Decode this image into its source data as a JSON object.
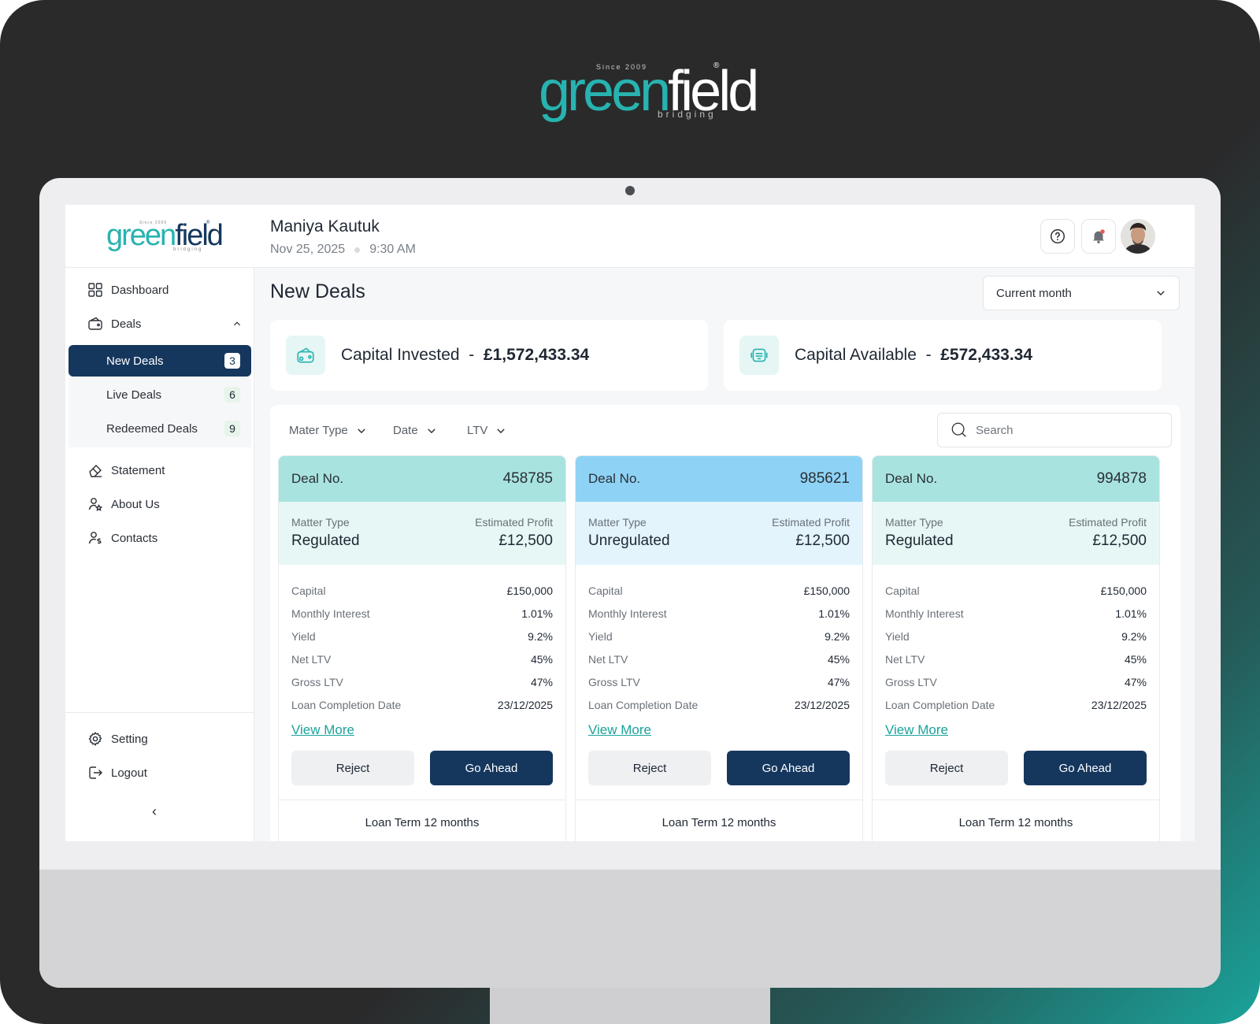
{
  "brand": {
    "prefix": "green",
    "suffix": "field",
    "since": "Since 2009",
    "sub": "bridging",
    "reg": "®"
  },
  "user": {
    "name": "Maniya Kautuk",
    "date": "Nov 25, 2025",
    "time": "9:30 AM"
  },
  "sidebar": {
    "items": [
      {
        "label": "Dashboard",
        "icon": "grid-icon"
      },
      {
        "label": "Deals",
        "icon": "wallet-icon"
      }
    ],
    "sub_items": [
      {
        "label": "New Deals",
        "count": "3"
      },
      {
        "label": "Live Deals",
        "count": "6"
      },
      {
        "label": "Redeemed Deals",
        "count": "9"
      }
    ],
    "more_items": [
      {
        "label": "Statement",
        "icon": "eraser-icon"
      },
      {
        "label": "About Us",
        "icon": "user-star-icon"
      },
      {
        "label": "Contacts",
        "icon": "user-dollar-icon"
      }
    ],
    "bottom_items": [
      {
        "label": "Setting",
        "icon": "gear-icon"
      },
      {
        "label": "Logout",
        "icon": "logout-icon"
      }
    ],
    "collapse_glyph": "‹"
  },
  "main": {
    "title": "New Deals",
    "period": "Current month",
    "capital_invested": {
      "label": "Capital Invested",
      "sep": "-",
      "value": "£1,572,433.34"
    },
    "capital_available": {
      "label": "Capital Available",
      "sep": "-",
      "value": "£572,433.34"
    },
    "filters": [
      "Mater Type",
      "Date",
      "LTV"
    ],
    "search_placeholder": "Search"
  },
  "deal_labels": {
    "deal_no": "Deal No.",
    "matter_type": "Matter Type",
    "estimated_profit": "Estimated Profit",
    "view_more": "View More",
    "reject": "Reject",
    "go_ahead": "Go Ahead"
  },
  "deals": [
    {
      "number": "458785",
      "matter": "Regulated",
      "profit": "£12,500",
      "head_color": "#a8e3df",
      "sub_color": "#e6f7f5",
      "rows": [
        [
          "Capital",
          "£150,000"
        ],
        [
          "Monthly Interest",
          "1.01%"
        ],
        [
          "Yield",
          "9.2%"
        ],
        [
          "Net LTV",
          "45%"
        ],
        [
          "Gross LTV",
          "47%"
        ],
        [
          "Loan Completion Date",
          "23/12/2025"
        ]
      ],
      "term": "Loan Term 12 months"
    },
    {
      "number": "985621",
      "matter": "Unregulated",
      "profit": "£12,500",
      "head_color": "#8ed3f5",
      "sub_color": "#e3f4fc",
      "rows": [
        [
          "Capital",
          "£150,000"
        ],
        [
          "Monthly Interest",
          "1.01%"
        ],
        [
          "Yield",
          "9.2%"
        ],
        [
          "Net LTV",
          "45%"
        ],
        [
          "Gross LTV",
          "47%"
        ],
        [
          "Loan Completion Date",
          "23/12/2025"
        ]
      ],
      "term": "Loan Term 12 months"
    },
    {
      "number": "994878",
      "matter": "Regulated",
      "profit": "£12,500",
      "head_color": "#a8e3df",
      "sub_color": "#e6f7f5",
      "rows": [
        [
          "Capital",
          "£150,000"
        ],
        [
          "Monthly Interest",
          "1.01%"
        ],
        [
          "Yield",
          "9.2%"
        ],
        [
          "Net LTV",
          "45%"
        ],
        [
          "Gross LTV",
          "47%"
        ],
        [
          "Loan Completion Date",
          "23/12/2025"
        ]
      ],
      "term": "Loan Term 12 months"
    }
  ],
  "colors": {
    "primary": "#15375e",
    "teal": "#27b3b0",
    "link": "#1aa39a"
  }
}
